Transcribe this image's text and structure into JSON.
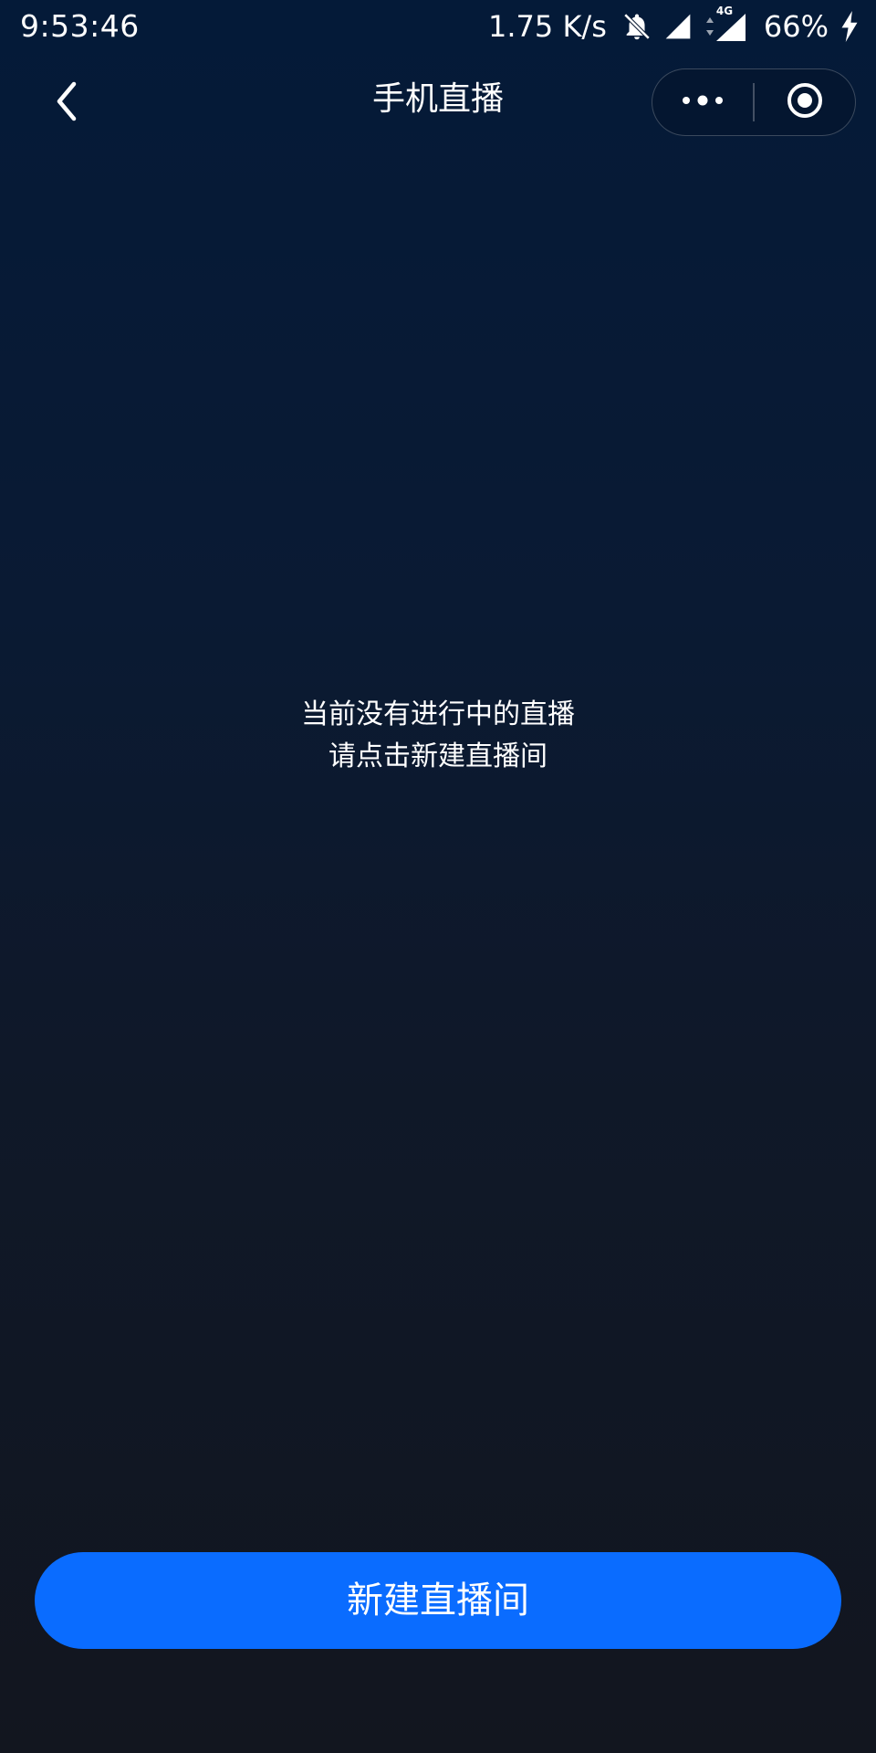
{
  "status_bar": {
    "time": "9:53:46",
    "network_speed": "1.75 K/s",
    "network_type": "4G",
    "battery_percent": "66%",
    "icons": [
      "notifications-off-icon",
      "signal-icon",
      "signal-4g-icon",
      "charging-icon"
    ]
  },
  "header": {
    "title": "手机直播",
    "back_icon": "chevron-left-icon",
    "menu_icon": "more-dots-icon",
    "close_icon": "target-close-icon"
  },
  "empty_state": {
    "line1": "当前没有进行中的直播",
    "line2": "请点击新建直播间"
  },
  "actions": {
    "create_room_label": "新建直播间"
  },
  "colors": {
    "background_top": "#041a38",
    "background_bottom": "#12161f",
    "primary_button": "#0a6cff",
    "text": "#ffffff"
  }
}
